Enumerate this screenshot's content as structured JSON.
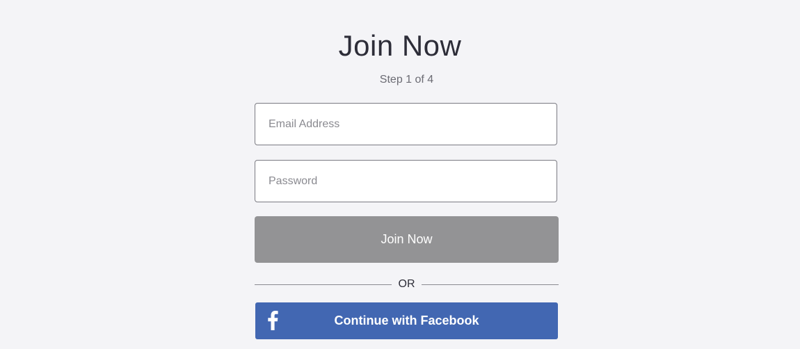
{
  "header": {
    "title": "Join Now",
    "step": "Step 1 of 4"
  },
  "form": {
    "email": {
      "placeholder": "Email Address",
      "value": ""
    },
    "password": {
      "placeholder": "Password",
      "value": ""
    },
    "submit_label": "Join Now"
  },
  "divider": {
    "label": "OR"
  },
  "facebook": {
    "label": "Continue with Facebook",
    "icon": "facebook-icon",
    "color": "#4267b2"
  },
  "colors": {
    "background": "#f4f4f7",
    "submit_button": "#939395",
    "facebook": "#4267b2"
  }
}
